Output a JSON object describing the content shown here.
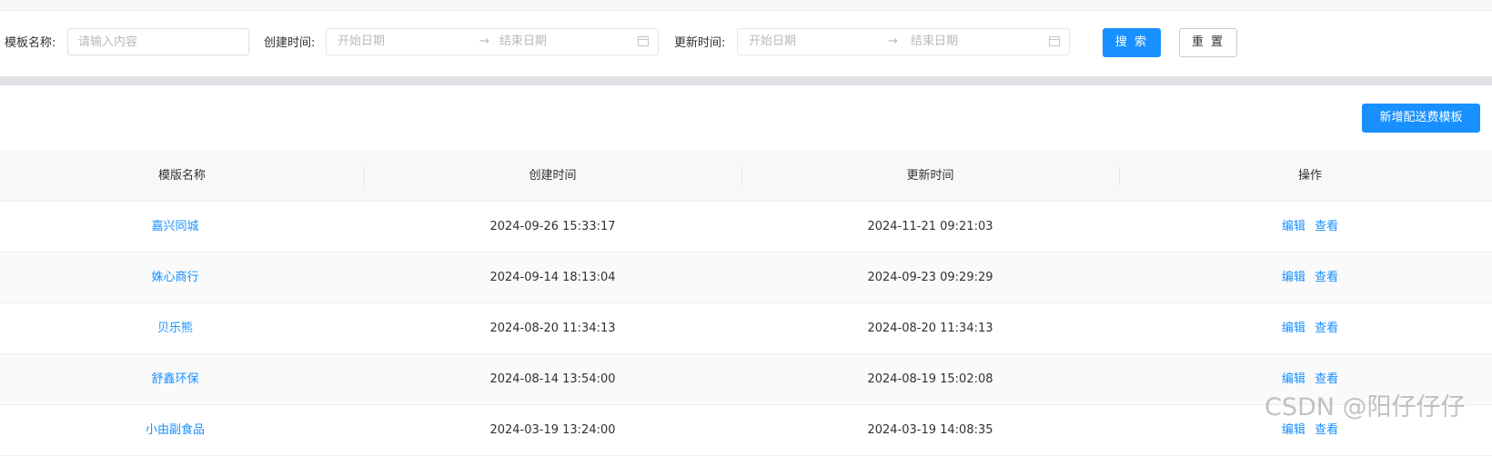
{
  "filters": {
    "template_name_label": "模板名称:",
    "template_name_placeholder": "请输入内容",
    "create_time_label": "创建时间:",
    "update_time_label": "更新时间:",
    "start_placeholder": "开始日期",
    "end_placeholder": "结束日期",
    "range_separator": "→",
    "search_label": "搜 索",
    "reset_label": "重 置"
  },
  "toolbar": {
    "add_label": "新增配送费模板"
  },
  "table": {
    "columns": [
      "模版名称",
      "创建时间",
      "更新时间",
      "操作"
    ],
    "rows": [
      {
        "name": "嘉兴同城",
        "created": "2024-09-26 15:33:17",
        "updated": "2024-11-21 09:21:03",
        "edit": "编辑",
        "view": "查看"
      },
      {
        "name": "姝心商行",
        "created": "2024-09-14 18:13:04",
        "updated": "2024-09-23 09:29:29",
        "edit": "编辑",
        "view": "查看"
      },
      {
        "name": "贝乐熊",
        "created": "2024-08-20 11:34:13",
        "updated": "2024-08-20 11:34:13",
        "edit": "编辑",
        "view": "查看"
      },
      {
        "name": "舒鑫环保",
        "created": "2024-08-14 13:54:00",
        "updated": "2024-08-19 15:02:08",
        "edit": "编辑",
        "view": "查看"
      },
      {
        "name": "小由副食品",
        "created": "2024-03-19 13:24:00",
        "updated": "2024-03-19 14:08:35",
        "edit": "编辑",
        "view": "查看"
      }
    ]
  },
  "watermark": "CSDN @阳仔仔仔",
  "colors": {
    "primary": "#1890ff",
    "link": "#1890ff",
    "header_bg": "#f7f8fa",
    "divider": "#dfe1e4"
  }
}
